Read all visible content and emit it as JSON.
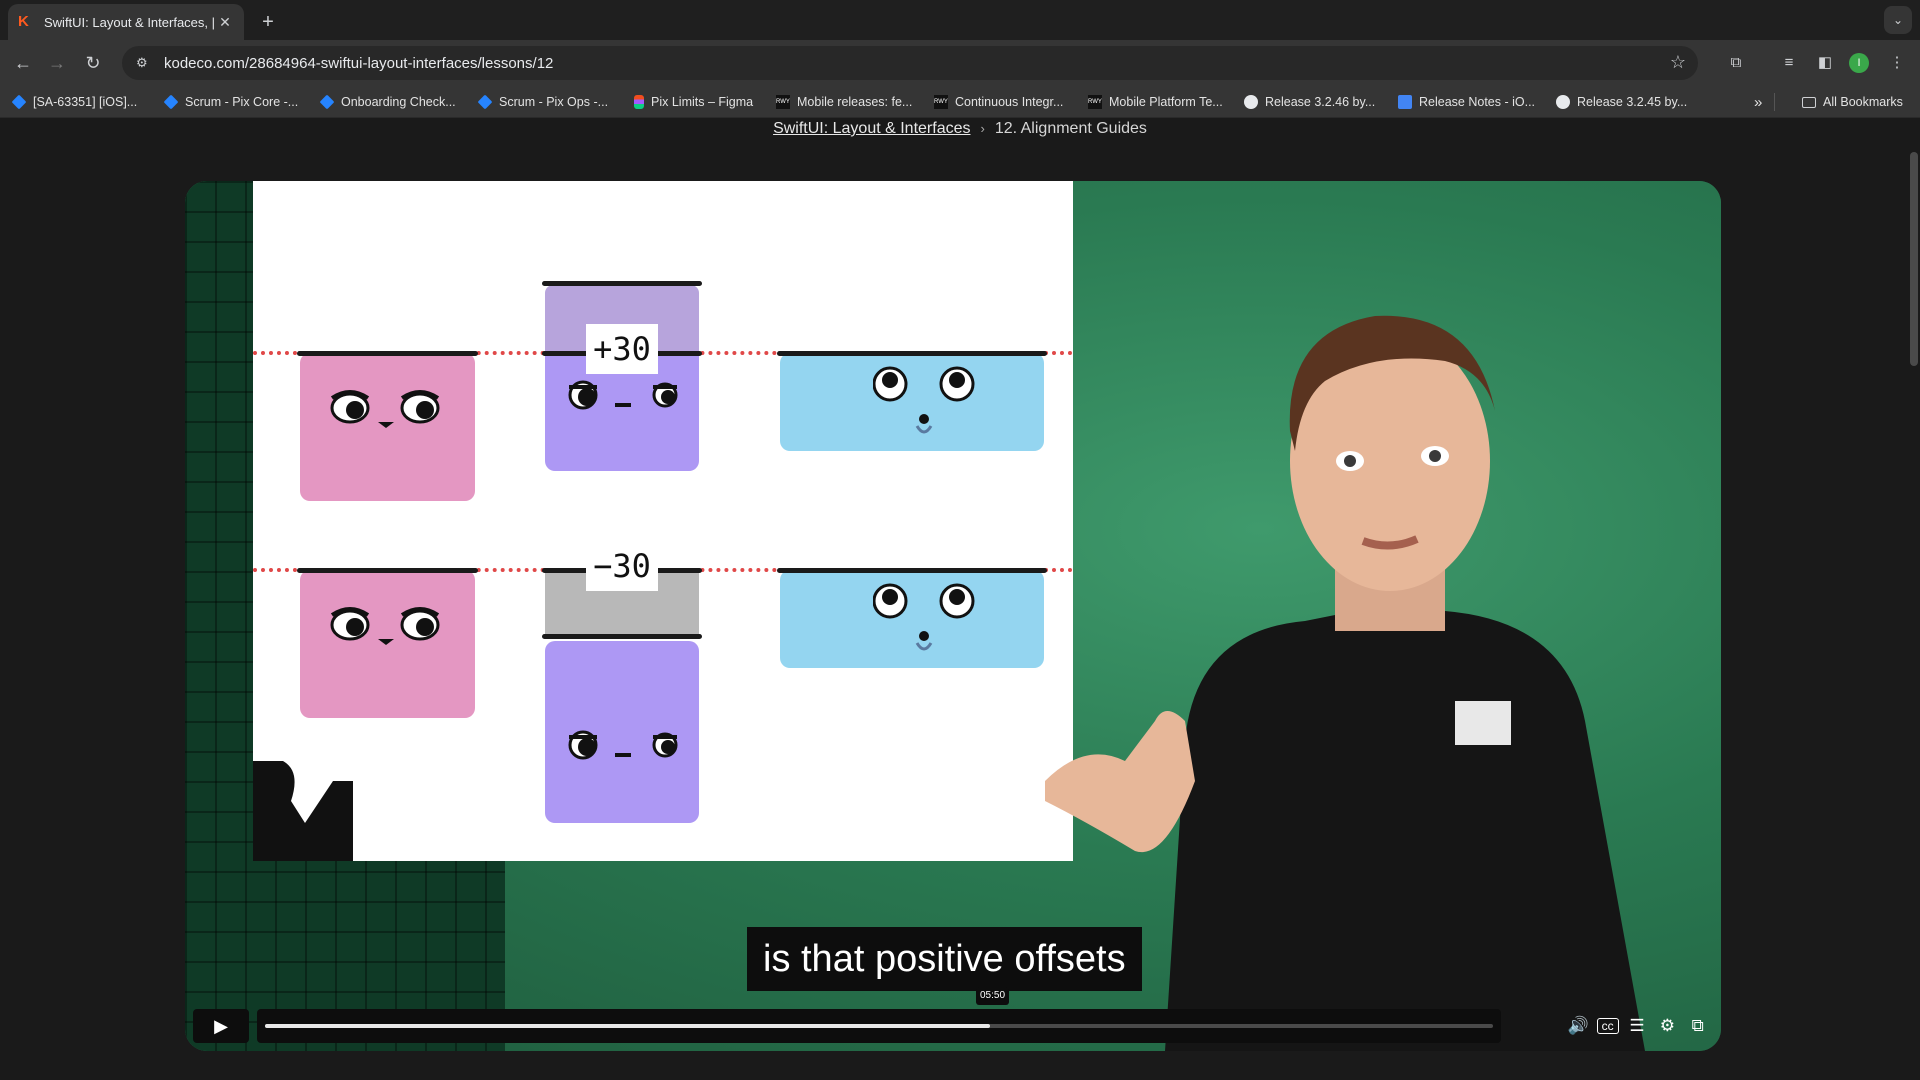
{
  "browser": {
    "tab_title": "SwiftUI: Layout & Interfaces, |",
    "tab_favicon": "K",
    "url": "kodeco.com/28684964-swiftui-layout-interfaces/lessons/12",
    "profile_initial": "I"
  },
  "bookmarks": [
    {
      "label": "[SA-63351] [iOS]...",
      "icon": "jira-icon"
    },
    {
      "label": "Scrum - Pix Core -...",
      "icon": "jira-icon"
    },
    {
      "label": "Onboarding Check...",
      "icon": "jira-icon"
    },
    {
      "label": "Scrum - Pix Ops -...",
      "icon": "jira-icon"
    },
    {
      "label": "Pix Limits – Figma",
      "icon": "figma-icon"
    },
    {
      "label": "Mobile releases: fe...",
      "icon": "rwy-icon"
    },
    {
      "label": "Continuous Integr...",
      "icon": "rwy-icon"
    },
    {
      "label": "Mobile Platform Te...",
      "icon": "rwy-icon"
    },
    {
      "label": "Release 3.2.46 by...",
      "icon": "github-icon"
    },
    {
      "label": "Release Notes - iO...",
      "icon": "docs-icon"
    },
    {
      "label": "Release 3.2.45 by...",
      "icon": "github-icon"
    }
  ],
  "bookmarks_overflow": "»",
  "all_bookmarks": "All Bookmarks",
  "breadcrumb": {
    "course": "SwiftUI: Layout & Interfaces",
    "separator": "›",
    "lesson": "12. Alignment Guides"
  },
  "slide": {
    "offset_positive": "+30",
    "offset_negative": "−30"
  },
  "video": {
    "subtitle": "is that positive offsets",
    "current_time": "05:50",
    "progress": 0.59
  },
  "colors": {
    "pink": "#e497c2",
    "purple": "#ad98f4",
    "blue": "#94d5f0",
    "guide_red": "#e04848"
  }
}
